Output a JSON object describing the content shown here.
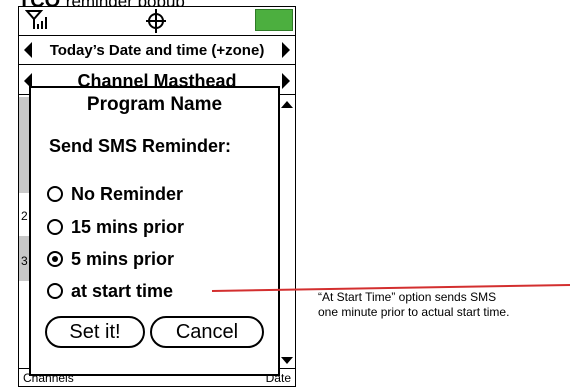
{
  "heading": {
    "prefix": "TCO",
    "text": "reminder popup"
  },
  "phone": {
    "date_label": "Today’s Date and time (+zone)",
    "masthead_label": "Channel Masthead",
    "side_labels": [
      "2",
      "3"
    ],
    "bottom_left": "Channels",
    "bottom_right": "Date",
    "icons": {
      "signal": "signal-strength-icon",
      "target": "crosshair-icon",
      "battery": "battery-icon"
    },
    "battery_color": "#4caf3f"
  },
  "popup": {
    "title": "Program Name",
    "subtitle": "Send SMS Reminder:",
    "options": [
      {
        "label": "No Reminder",
        "selected": false
      },
      {
        "label": "15 mins prior",
        "selected": false
      },
      {
        "label": "5 mins prior",
        "selected": true
      },
      {
        "label": "at start time",
        "selected": false
      }
    ],
    "set_button": "Set it!",
    "cancel_button": "Cancel"
  },
  "annotation": {
    "line1": "“At Start Time” option sends SMS",
    "line2": "one minute prior to actual start time.",
    "line_color": "#d32f2f"
  }
}
